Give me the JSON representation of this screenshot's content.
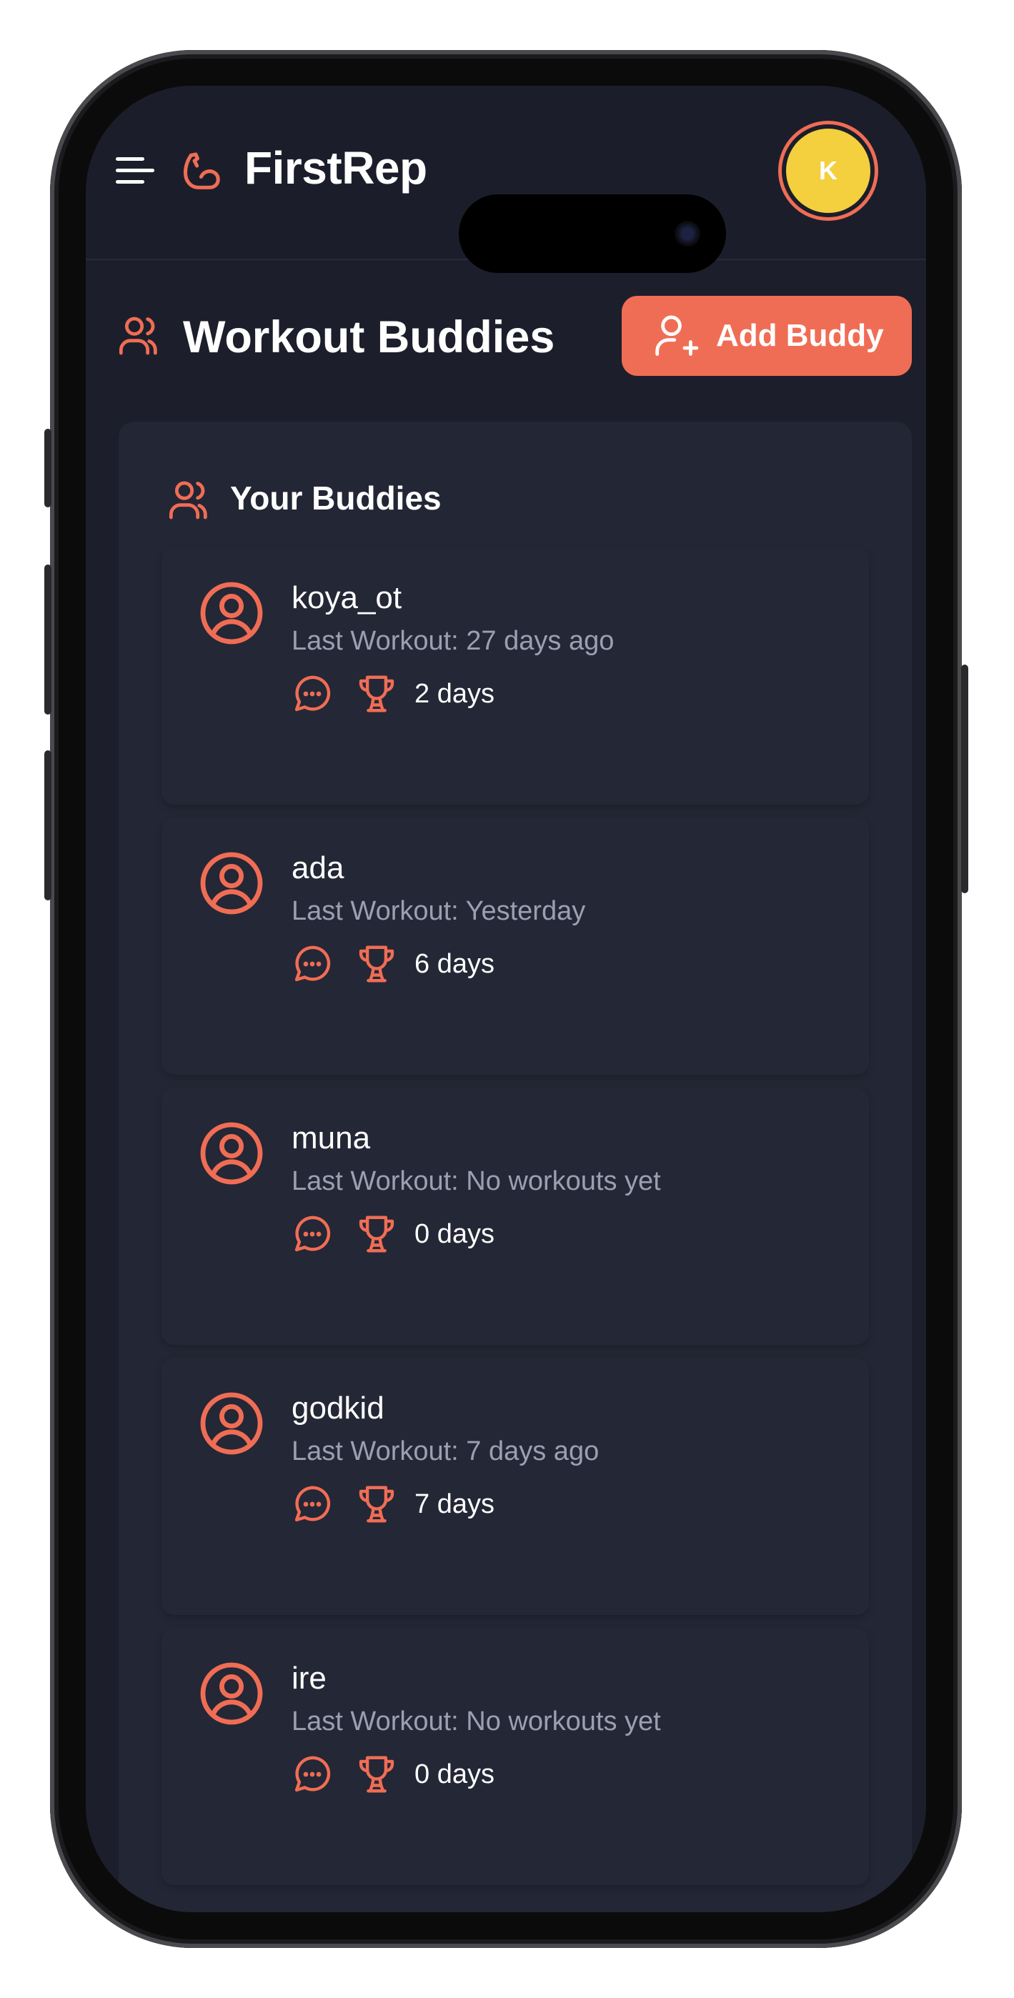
{
  "app": {
    "brand": "FirstRep",
    "avatar_initial": "K"
  },
  "page": {
    "title": "Workout Buddies",
    "add_button_label": "Add Buddy"
  },
  "panel": {
    "title": "Your Buddies"
  },
  "buddies": [
    {
      "name": "koya_ot",
      "last_workout": "Last Workout: 27 days ago",
      "streak": "2 days"
    },
    {
      "name": "ada",
      "last_workout": "Last Workout: Yesterday",
      "streak": "6 days"
    },
    {
      "name": "muna",
      "last_workout": "Last Workout: No workouts yet",
      "streak": "0 days"
    },
    {
      "name": "godkid",
      "last_workout": "Last Workout: 7 days ago",
      "streak": "7 days"
    },
    {
      "name": "ire",
      "last_workout": "Last Workout: No workouts yet",
      "streak": "0 days"
    }
  ],
  "icons": {
    "menu": "menu-icon",
    "logo": "flexed-bicep-icon",
    "heading": "users-icon",
    "add": "user-plus-icon",
    "buddy": "user-circle-icon",
    "message": "message-dots-icon",
    "trophy": "trophy-icon"
  },
  "colors": {
    "accent": "#f06d55",
    "avatar": "#f4cf3e",
    "background": "#1c1f2b",
    "panel": "#232634",
    "muted_text": "#9aa0b2"
  }
}
